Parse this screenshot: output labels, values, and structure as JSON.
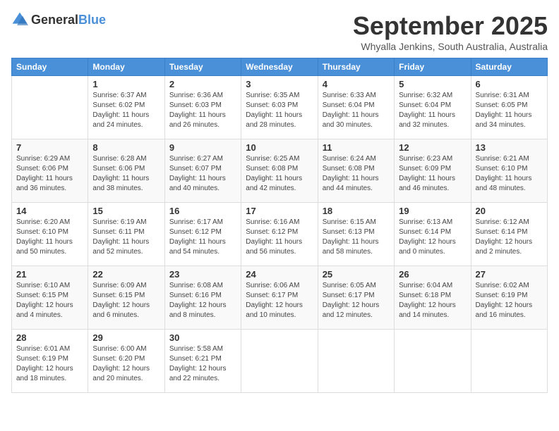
{
  "logo": {
    "general": "General",
    "blue": "Blue"
  },
  "title": "September 2025",
  "subtitle": "Whyalla Jenkins, South Australia, Australia",
  "calendar": {
    "headers": [
      "Sunday",
      "Monday",
      "Tuesday",
      "Wednesday",
      "Thursday",
      "Friday",
      "Saturday"
    ],
    "weeks": [
      [
        {
          "day": "",
          "info": ""
        },
        {
          "day": "1",
          "info": "Sunrise: 6:37 AM\nSunset: 6:02 PM\nDaylight: 11 hours\nand 24 minutes."
        },
        {
          "day": "2",
          "info": "Sunrise: 6:36 AM\nSunset: 6:03 PM\nDaylight: 11 hours\nand 26 minutes."
        },
        {
          "day": "3",
          "info": "Sunrise: 6:35 AM\nSunset: 6:03 PM\nDaylight: 11 hours\nand 28 minutes."
        },
        {
          "day": "4",
          "info": "Sunrise: 6:33 AM\nSunset: 6:04 PM\nDaylight: 11 hours\nand 30 minutes."
        },
        {
          "day": "5",
          "info": "Sunrise: 6:32 AM\nSunset: 6:04 PM\nDaylight: 11 hours\nand 32 minutes."
        },
        {
          "day": "6",
          "info": "Sunrise: 6:31 AM\nSunset: 6:05 PM\nDaylight: 11 hours\nand 34 minutes."
        }
      ],
      [
        {
          "day": "7",
          "info": "Sunrise: 6:29 AM\nSunset: 6:06 PM\nDaylight: 11 hours\nand 36 minutes."
        },
        {
          "day": "8",
          "info": "Sunrise: 6:28 AM\nSunset: 6:06 PM\nDaylight: 11 hours\nand 38 minutes."
        },
        {
          "day": "9",
          "info": "Sunrise: 6:27 AM\nSunset: 6:07 PM\nDaylight: 11 hours\nand 40 minutes."
        },
        {
          "day": "10",
          "info": "Sunrise: 6:25 AM\nSunset: 6:08 PM\nDaylight: 11 hours\nand 42 minutes."
        },
        {
          "day": "11",
          "info": "Sunrise: 6:24 AM\nSunset: 6:08 PM\nDaylight: 11 hours\nand 44 minutes."
        },
        {
          "day": "12",
          "info": "Sunrise: 6:23 AM\nSunset: 6:09 PM\nDaylight: 11 hours\nand 46 minutes."
        },
        {
          "day": "13",
          "info": "Sunrise: 6:21 AM\nSunset: 6:10 PM\nDaylight: 11 hours\nand 48 minutes."
        }
      ],
      [
        {
          "day": "14",
          "info": "Sunrise: 6:20 AM\nSunset: 6:10 PM\nDaylight: 11 hours\nand 50 minutes."
        },
        {
          "day": "15",
          "info": "Sunrise: 6:19 AM\nSunset: 6:11 PM\nDaylight: 11 hours\nand 52 minutes."
        },
        {
          "day": "16",
          "info": "Sunrise: 6:17 AM\nSunset: 6:12 PM\nDaylight: 11 hours\nand 54 minutes."
        },
        {
          "day": "17",
          "info": "Sunrise: 6:16 AM\nSunset: 6:12 PM\nDaylight: 11 hours\nand 56 minutes."
        },
        {
          "day": "18",
          "info": "Sunrise: 6:15 AM\nSunset: 6:13 PM\nDaylight: 11 hours\nand 58 minutes."
        },
        {
          "day": "19",
          "info": "Sunrise: 6:13 AM\nSunset: 6:14 PM\nDaylight: 12 hours\nand 0 minutes."
        },
        {
          "day": "20",
          "info": "Sunrise: 6:12 AM\nSunset: 6:14 PM\nDaylight: 12 hours\nand 2 minutes."
        }
      ],
      [
        {
          "day": "21",
          "info": "Sunrise: 6:10 AM\nSunset: 6:15 PM\nDaylight: 12 hours\nand 4 minutes."
        },
        {
          "day": "22",
          "info": "Sunrise: 6:09 AM\nSunset: 6:15 PM\nDaylight: 12 hours\nand 6 minutes."
        },
        {
          "day": "23",
          "info": "Sunrise: 6:08 AM\nSunset: 6:16 PM\nDaylight: 12 hours\nand 8 minutes."
        },
        {
          "day": "24",
          "info": "Sunrise: 6:06 AM\nSunset: 6:17 PM\nDaylight: 12 hours\nand 10 minutes."
        },
        {
          "day": "25",
          "info": "Sunrise: 6:05 AM\nSunset: 6:17 PM\nDaylight: 12 hours\nand 12 minutes."
        },
        {
          "day": "26",
          "info": "Sunrise: 6:04 AM\nSunset: 6:18 PM\nDaylight: 12 hours\nand 14 minutes."
        },
        {
          "day": "27",
          "info": "Sunrise: 6:02 AM\nSunset: 6:19 PM\nDaylight: 12 hours\nand 16 minutes."
        }
      ],
      [
        {
          "day": "28",
          "info": "Sunrise: 6:01 AM\nSunset: 6:19 PM\nDaylight: 12 hours\nand 18 minutes."
        },
        {
          "day": "29",
          "info": "Sunrise: 6:00 AM\nSunset: 6:20 PM\nDaylight: 12 hours\nand 20 minutes."
        },
        {
          "day": "30",
          "info": "Sunrise: 5:58 AM\nSunset: 6:21 PM\nDaylight: 12 hours\nand 22 minutes."
        },
        {
          "day": "",
          "info": ""
        },
        {
          "day": "",
          "info": ""
        },
        {
          "day": "",
          "info": ""
        },
        {
          "day": "",
          "info": ""
        }
      ]
    ]
  }
}
